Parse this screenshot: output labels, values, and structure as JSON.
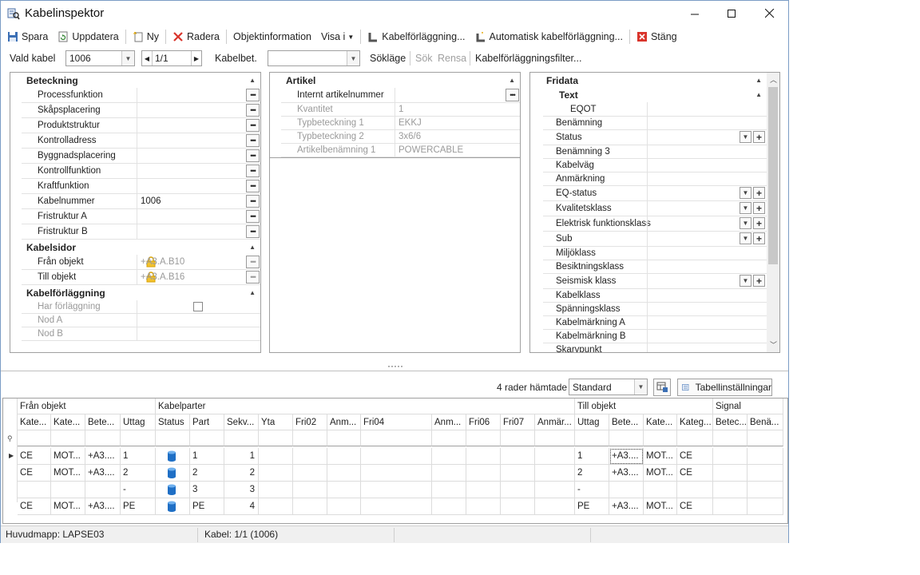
{
  "window": {
    "title": "Kabelinspektor"
  },
  "toolbar": {
    "save": "Spara",
    "update": "Uppdatera",
    "new": "Ny",
    "delete": "Radera",
    "object_info": "Objektinformation",
    "show_in": "Visa i",
    "cable_routing": "Kabelförläggning...",
    "auto_routing": "Automatisk kabelförläggning...",
    "close": "Stäng"
  },
  "selection": {
    "cable_label": "Vald kabel",
    "cable_value": "1006",
    "page": "1/1",
    "cablebet_label": "Kabelbet.",
    "cablebet_value": "",
    "search_mode": "Sökläge",
    "search": "Sök",
    "clear": "Rensa",
    "routing_filter": "Kabelförläggningsfilter..."
  },
  "left_panel": {
    "group1": "Beteckning",
    "rows": [
      {
        "label": "Processfunktion",
        "value": ""
      },
      {
        "label": "Skåpsplacering",
        "value": ""
      },
      {
        "label": "Produktstruktur",
        "value": ""
      },
      {
        "label": "Kontrolladress",
        "value": ""
      },
      {
        "label": "Byggnadsplacering",
        "value": ""
      },
      {
        "label": "Kontrollfunktion",
        "value": ""
      },
      {
        "label": "Kraftfunktion",
        "value": ""
      },
      {
        "label": "Kabelnummer",
        "value": "1006"
      },
      {
        "label": "Fristruktur A",
        "value": ""
      },
      {
        "label": "Fristruktur B",
        "value": ""
      }
    ],
    "group2": "Kabelsidor",
    "side_rows": [
      {
        "label": "Från objekt",
        "value": "+A3.A.B10"
      },
      {
        "label": "Till objekt",
        "value": "+A3.A.B16"
      }
    ],
    "group3": "Kabelförläggning",
    "routing_rows": [
      {
        "label": "Har förläggning",
        "value": ""
      },
      {
        "label": "Nod A",
        "value": ""
      },
      {
        "label": "Nod B",
        "value": ""
      }
    ]
  },
  "mid_panel": {
    "group": "Artikel",
    "rows": [
      {
        "label": "Internt artikelnummer",
        "value": ""
      },
      {
        "label": "Kvantitet",
        "value": "1"
      },
      {
        "label": "Typbeteckning 1",
        "value": "EKKJ"
      },
      {
        "label": "Typbeteckning 2",
        "value": "3x6/6"
      },
      {
        "label": "Artikelbenämning 1",
        "value": "POWERCABLE"
      }
    ]
  },
  "right_panel": {
    "group": "Fridata",
    "subgroup": "Text",
    "rows": [
      {
        "label": "EQOT",
        "value": "",
        "dd": false
      },
      {
        "label": "Benämning",
        "value": "",
        "dd": false
      },
      {
        "label": "Status",
        "value": "",
        "dd": true
      },
      {
        "label": "Benämning 3",
        "value": "",
        "dd": false
      },
      {
        "label": "Kabelväg",
        "value": "",
        "dd": false
      },
      {
        "label": "Anmärkning",
        "value": "",
        "dd": false
      },
      {
        "label": "EQ-status",
        "value": "",
        "dd": true
      },
      {
        "label": "Kvalitetsklass",
        "value": "",
        "dd": true
      },
      {
        "label": "Elektrisk funktionsklass",
        "value": "",
        "dd": true
      },
      {
        "label": "Sub",
        "value": "",
        "dd": true
      },
      {
        "label": "Miljöklass",
        "value": "",
        "dd": false
      },
      {
        "label": "Besiktningsklass",
        "value": "",
        "dd": false
      },
      {
        "label": "Seismisk klass",
        "value": "",
        "dd": true
      },
      {
        "label": "Kabelklass",
        "value": "",
        "dd": false
      },
      {
        "label": "Spänningsklass",
        "value": "",
        "dd": false
      },
      {
        "label": "Kabelmärkning A",
        "value": "",
        "dd": false
      },
      {
        "label": "Kabelmärkning B",
        "value": "",
        "dd": false
      },
      {
        "label": "Skarvpunkt",
        "value": "",
        "dd": false
      }
    ]
  },
  "grid_toolbar": {
    "rows_fetched": "4 rader hämtade",
    "view": "Standard",
    "table_settings": "Tabellinställningar"
  },
  "grid": {
    "bands": [
      "Från objekt",
      "Kabelparter",
      "Till objekt",
      "Signal"
    ],
    "columns": [
      "Kate...",
      "Kate...",
      "Bete...",
      "Uttag",
      "Status",
      "Part",
      "Sekv...",
      "Yta",
      "Fri02",
      "Anm...",
      "Fri04",
      "Anm...",
      "Fri06",
      "Fri07",
      "Anmär...",
      "Uttag",
      "Bete...",
      "Kate...",
      "Kateg...",
      "Betec...",
      "Benä..."
    ],
    "rows": [
      [
        "CE",
        "MOT...",
        "+A3....",
        "1",
        "",
        "1",
        "1",
        "",
        "",
        "",
        "",
        "",
        "",
        "",
        "",
        "1",
        "+A3....",
        "MOT...",
        "CE",
        "",
        ""
      ],
      [
        "CE",
        "MOT...",
        "+A3....",
        "2",
        "",
        "2",
        "2",
        "",
        "",
        "",
        "",
        "",
        "",
        "",
        "",
        "2",
        "+A3....",
        "MOT...",
        "CE",
        "",
        ""
      ],
      [
        "",
        "",
        "",
        "-",
        "",
        "3",
        "3",
        "",
        "",
        "",
        "",
        "",
        "",
        "",
        "",
        "-",
        "",
        "",
        "",
        "",
        ""
      ],
      [
        "CE",
        "MOT...",
        "+A3....",
        "PE",
        "",
        "PE",
        "4",
        "",
        "",
        "",
        "",
        "",
        "",
        "",
        "",
        "PE",
        "+A3....",
        "MOT...",
        "CE",
        "",
        ""
      ]
    ]
  },
  "statusbar": {
    "folder": "Huvudmapp: LAPSE03",
    "cable": "Kabel: 1/1 (1006)"
  },
  "colors": {
    "accent": "#2f6fb6",
    "delete_red": "#d9342b",
    "status_icon": "#1f6fc5"
  }
}
